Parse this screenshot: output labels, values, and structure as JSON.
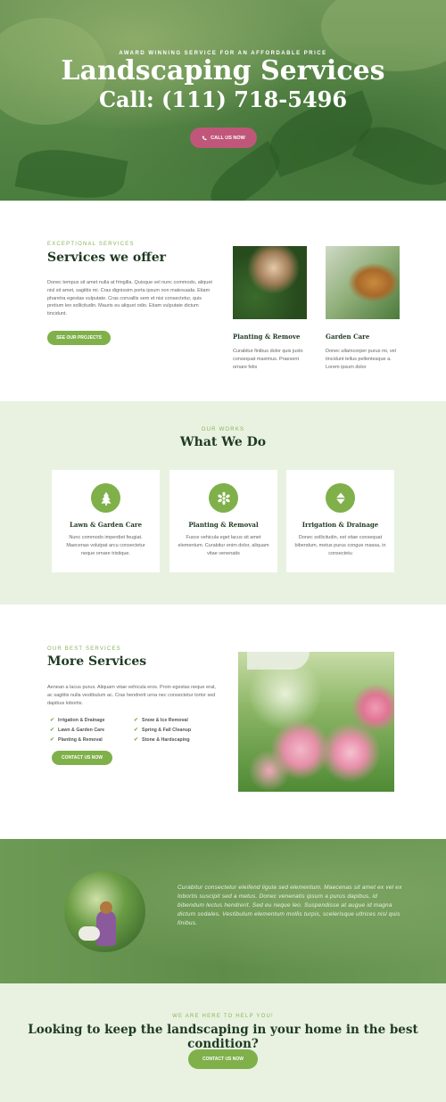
{
  "hero": {
    "tagline": "AWARD WINNING SERVICE FOR AN AFFORDABLE PRICE",
    "title": "Landscaping Services",
    "phone": "Call: (111) 718-5496",
    "cta_label": "CALL US NOW",
    "cta_icon": "phone-icon"
  },
  "offer": {
    "eyebrow": "EXCEPTIONAL SERVICES",
    "heading": "Services we offer",
    "body": "Donec tempus sit amet nulla at fringilla. Quisque vel nunc commodo, aliquet nisl sit amet, sagittis mi. Cras dignissim porta ipsum non malesuada. Etiam pharetra egestas vulputate. Cras convallis sem et nisi consectetur, quis pretium leo sollicitudin. Mauris eu aliquet odio. Etiam vulputate dictum tincidunt.",
    "button": "SEE OUR PROJECTS",
    "cards": [
      {
        "title": "Planting & Remove",
        "text": "Curabitur finibus dolor quis justo consequat maximus. Praesent ornare felis"
      },
      {
        "title": "Garden Care",
        "text": "Donec ullamcorper purus mi, vel tincidunt tellus pellentesque a. Lorem ipsum dolor"
      }
    ]
  },
  "whatwedo": {
    "eyebrow": "OUR WORKS",
    "heading": "What We Do",
    "cards": [
      {
        "title": "Lawn & Garden Care",
        "text": "Nunc commodo imperdiet feugiat. Maecenas volutpat arcu consectetur neque ornare tristique.",
        "icon": "tree-icon"
      },
      {
        "title": "Planting & Removal",
        "text": "Fusce vehicula eget lacus sit amet elementum. Curabitur enim dolor, aliquam vitae venenatis",
        "icon": "flower-icon"
      },
      {
        "title": "Irrigation & Drainage",
        "text": "Donec sollicitudin, est vitae consequat bibendum, metus purus congue massa, in consectetu",
        "icon": "arrows-icon"
      }
    ]
  },
  "more": {
    "eyebrow": "OUR BEST SERVICES",
    "heading": "More Services",
    "body": "Aenean a lacus purus. Aliquam vitae vehicula eros. Proin egestas neque erat, ac sagittis nulla vestibulum ac. Cras hendrerit urna nec consectetur tortor sed dapibus lobortis.",
    "list": [
      "Irrigation & Drainage",
      "Snow & Ice Removal",
      "Lawn & Garden Care",
      "Spring & Fall Cleanup",
      "Planting & Removal",
      "Stone & Hardscaping"
    ],
    "button": "CONTACT US NOW"
  },
  "testimonial": {
    "quote": "Curabitur consectetur eleifend ligula sed elementum. Maecenas sit amet ex vel ex lobortis suscipit sed a metus. Donec venenatis ipsum a purus dapibus, id bibendum lectus hendrerit. Sed eu neque leo. Suspendisse at augue id magna dictum sodales. Vestibulum elementum mollis turpis, scelerisque ultrices nisl quis finibus."
  },
  "cta": {
    "eyebrow": "WE ARE HERE TO HELP YOU!",
    "heading": "Looking to keep the landscaping in your home in the best condition?",
    "button": "CONTACT US NOW"
  },
  "colors": {
    "accent_green": "#7fb04a",
    "dark_green": "#1f3a22",
    "pink": "#c0577a",
    "light_bg": "#e9f2e1"
  }
}
